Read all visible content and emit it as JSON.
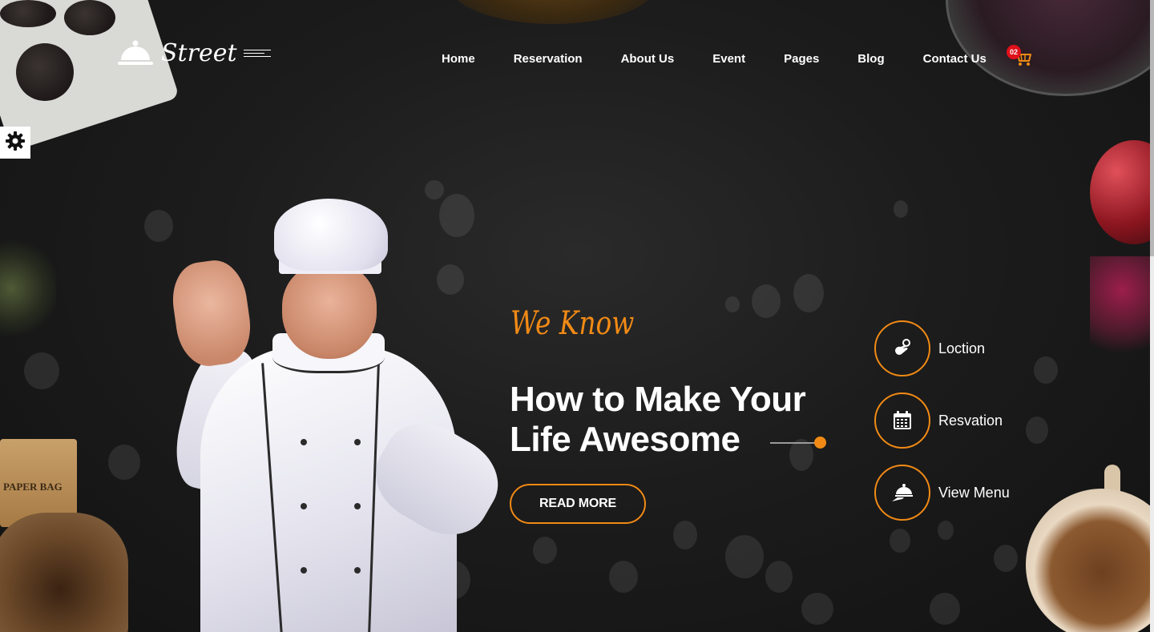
{
  "brand": {
    "name": "Street",
    "accent_color": "#f18a15",
    "logo_icon": "cloche-icon"
  },
  "nav": {
    "items": [
      {
        "label": "Home"
      },
      {
        "label": "Reservation"
      },
      {
        "label": "About Us"
      },
      {
        "label": "Event"
      },
      {
        "label": "Pages"
      },
      {
        "label": "Blog"
      },
      {
        "label": "Contact Us"
      }
    ],
    "cart": {
      "count": "02",
      "icon": "shopping-cart-icon",
      "badge_color": "#e0101b"
    }
  },
  "settings": {
    "icon": "gear-icon"
  },
  "hero": {
    "eyebrow": "We Know",
    "headline_line1": "How to Make Your",
    "headline_line2": "Life Awesome",
    "cta_label": "READ MORE"
  },
  "actions": [
    {
      "label": "Loction",
      "icon": "location-hand-icon"
    },
    {
      "label": "Resvation",
      "icon": "calendar-icon"
    },
    {
      "label": "View Menu",
      "icon": "cloche-hand-icon"
    }
  ],
  "props": {
    "coffee_bag_label": "PAPER BAG"
  }
}
